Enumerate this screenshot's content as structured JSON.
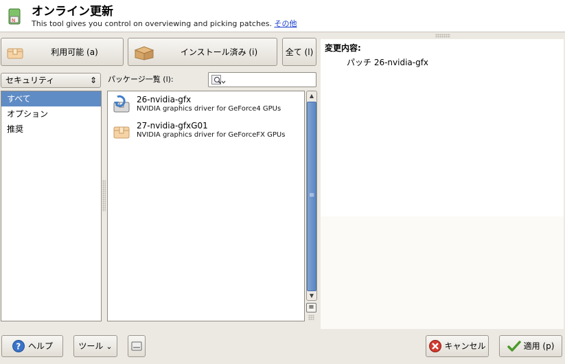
{
  "header": {
    "title": "オンライン更新",
    "subtitle": "This tool gives you control on overviewing and picking patches.",
    "more_link": "その他"
  },
  "view_buttons": {
    "available": "利用可能 (a)",
    "installed": "インストール済み (i)",
    "all": "全て (l)"
  },
  "filter": {
    "selected": "セキュリティ",
    "categories": [
      "すべて",
      "オプション",
      "推奨"
    ],
    "selected_category_index": 0
  },
  "packages": {
    "list_label": "パッケージ一覧 (l):",
    "search_value": "",
    "items": [
      {
        "name": "26-nvidia-gfx",
        "description": "NVIDIA graphics driver for GeForce4 GPUs",
        "icon": "package-update-icon"
      },
      {
        "name": "27-nvidia-gfxG01",
        "description": "NVIDIA graphics driver for GeForceFX GPUs",
        "icon": "package-icon"
      }
    ]
  },
  "details": {
    "heading": "変更内容:",
    "item": "パッチ 26-nvidia-gfx"
  },
  "footer": {
    "help": "ヘルプ",
    "tools": "ツール",
    "cancel": "キャンセル",
    "apply": "適用 (p)"
  },
  "colors": {
    "selection": "#5f8cc5",
    "scroll_thumb": "#6b94cb",
    "link": "#1a3fcc"
  }
}
